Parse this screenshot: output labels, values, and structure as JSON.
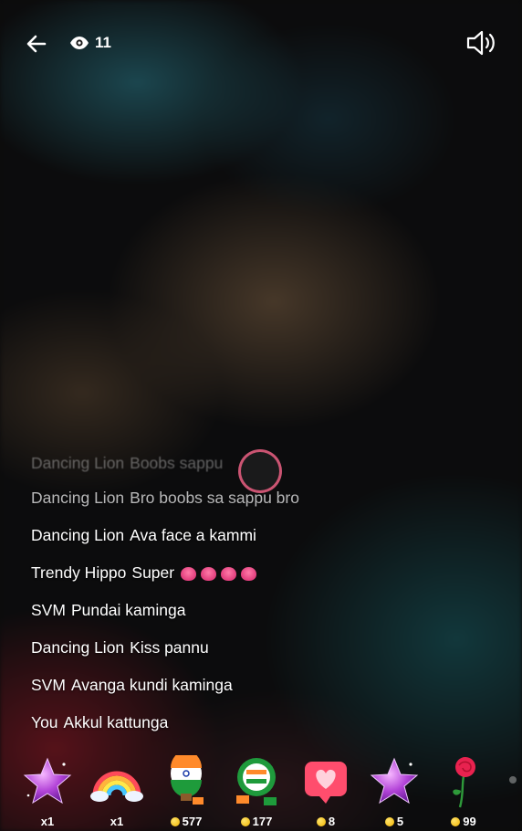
{
  "header": {
    "viewer_count": "11"
  },
  "chat": {
    "messages": [
      {
        "user": "Dancing Lion",
        "text": "Boobs sappu",
        "faint": "1"
      },
      {
        "user": "Dancing Lion",
        "text": "Bro boobs sa sappu bro",
        "faint": "2"
      },
      {
        "user": "Dancing Lion",
        "text": "Ava face a kammi"
      },
      {
        "user": "Trendy Hippo",
        "text": "Super",
        "emoji": "blush-emoji x4"
      },
      {
        "user": "SVM",
        "text": "Pundai kaminga"
      },
      {
        "user": "Dancing Lion",
        "text": "Kiss pannu"
      },
      {
        "user": "SVM",
        "text": "Avanga kundi kaminga"
      },
      {
        "user": "You",
        "text": "Akkul kattunga"
      }
    ]
  },
  "gifts": [
    {
      "icon": "star-gift-icon",
      "price": "x1",
      "coin": false
    },
    {
      "icon": "rainbow-gift-icon",
      "price": "x1",
      "coin": false
    },
    {
      "icon": "balloon-gift-icon",
      "price": "577",
      "coin": true
    },
    {
      "icon": "flag-badge-gift-icon",
      "price": "177",
      "coin": true
    },
    {
      "icon": "heart-bubble-gift-icon",
      "price": "8",
      "coin": true
    },
    {
      "icon": "star-gift-icon",
      "price": "5",
      "coin": true
    },
    {
      "icon": "rose-gift-icon",
      "price": "99",
      "coin": true
    }
  ],
  "colors": {
    "coin": "#f1b400",
    "ring": "#eb5f82",
    "heart": "#ff4d6d"
  }
}
